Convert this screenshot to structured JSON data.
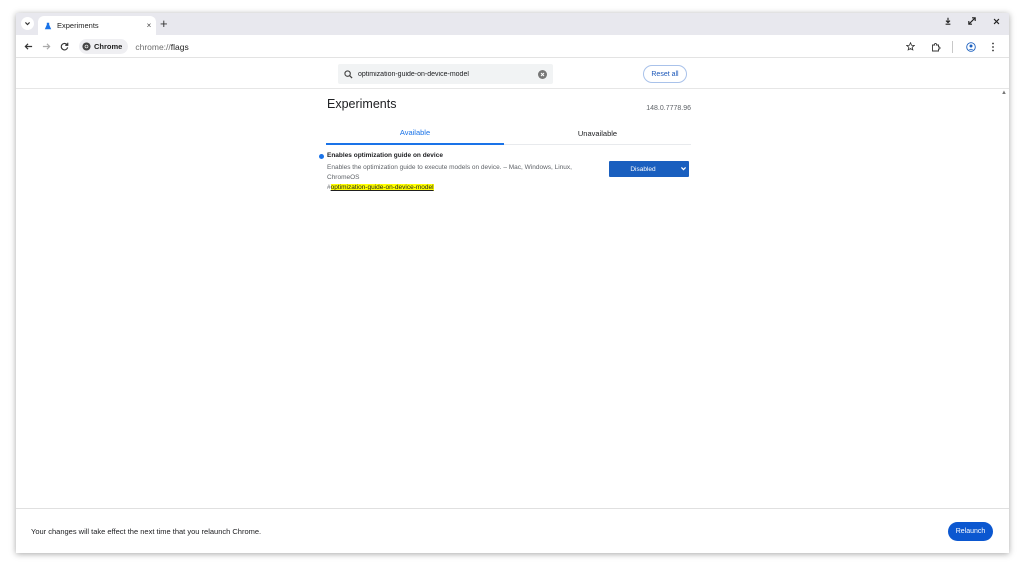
{
  "browser": {
    "tab": {
      "title": "Experiments",
      "close_glyph": "×"
    },
    "new_tab_glyph": "+",
    "omnibox": {
      "chip_label": "Chrome",
      "url_scheme": "chrome://",
      "url_path": "flags"
    }
  },
  "flags": {
    "search": {
      "value": "optimization-guide-on-device-model"
    },
    "reset_all_label": "Reset all",
    "title": "Experiments",
    "version": "148.0.7778.96",
    "tabs": [
      {
        "label": "Available",
        "selected": true
      },
      {
        "label": "Unavailable",
        "selected": false
      }
    ],
    "experiments": [
      {
        "name": "Enables optimization guide on device",
        "description": "Enables the optimization guide to execute models on device. – Mac, Windows, Linux, ChromeOS",
        "link_hash": "#",
        "link_text": "optimization-guide-on-device-model",
        "selected_option": "Disabled"
      }
    ]
  },
  "bottom_bar": {
    "message": "Your changes will take effect the next time that you relaunch Chrome.",
    "relaunch_label": "Relaunch"
  },
  "colors": {
    "accent": "#1a73e8",
    "select_bg": "#1a5fbf",
    "relaunch_bg": "#0b57d0",
    "highlight": "#ffff00"
  }
}
